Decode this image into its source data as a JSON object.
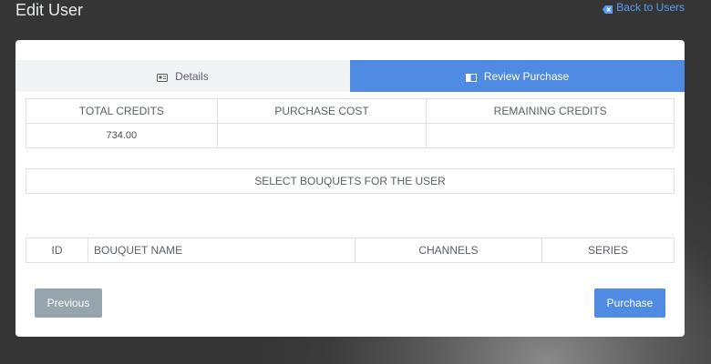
{
  "header": {
    "title": "Edit User",
    "back_link": "Back to Users"
  },
  "tabs": [
    {
      "label": "Details",
      "icon": "id-card-icon",
      "active": false
    },
    {
      "label": "Review Purchase",
      "icon": "book-icon",
      "active": true
    }
  ],
  "credits": {
    "headers": [
      "TOTAL CREDITS",
      "PURCHASE COST",
      "REMAINING CREDITS"
    ],
    "values": [
      "734.00",
      "",
      ""
    ]
  },
  "bouquets": {
    "section_title": "SELECT BOUQUETS FOR THE USER",
    "columns": [
      "ID",
      "BOUQUET NAME",
      "CHANNELS",
      "SERIES"
    ]
  },
  "buttons": {
    "previous": "Previous",
    "purchase": "Purchase"
  },
  "colors": {
    "accent": "#4f8ae3",
    "link": "#5b9bf0",
    "secondary_button": "#95a4ad"
  }
}
